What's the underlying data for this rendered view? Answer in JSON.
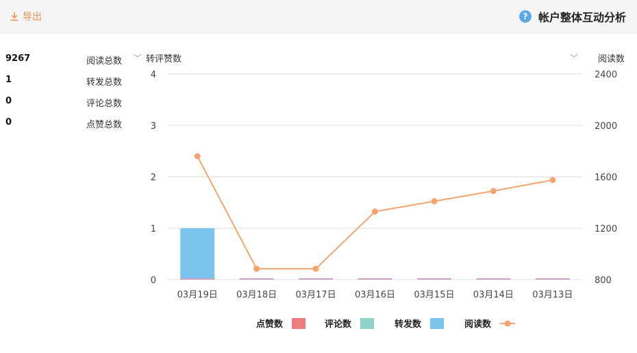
{
  "header": {
    "export_label": "导出",
    "title": "帐户整体互动分析",
    "help_symbol": "?"
  },
  "stats": [
    {
      "label": "阅读总数",
      "value": "9267"
    },
    {
      "label": "转发总数",
      "value": "1"
    },
    {
      "label": "评论总数",
      "value": "0"
    },
    {
      "label": "点赞总数",
      "value": "0"
    }
  ],
  "selectors": {
    "left": "转评赞数",
    "right": "阅读数"
  },
  "colors": {
    "read": "#f5a46f",
    "forward": "#7cc6ee",
    "comment": "#8fd3c9",
    "like": "#ee7d80",
    "grid": "#dddddd",
    "accent": "#f0914e"
  },
  "chart_data": {
    "type": "bar",
    "categories": [
      "03月13日",
      "03月14日",
      "03月15日",
      "03月16日",
      "03月17日",
      "03月18日",
      "03月19日"
    ],
    "series": [
      {
        "name": "阅读数",
        "kind": "line",
        "axis": "right",
        "values": [
          1575,
          1490,
          1410,
          1330,
          885,
          885,
          1760
        ]
      },
      {
        "name": "转发数",
        "kind": "bar",
        "axis": "left",
        "values": [
          0,
          0,
          0,
          0,
          0,
          0,
          1
        ]
      },
      {
        "name": "评论数",
        "kind": "bar",
        "axis": "left",
        "values": [
          0,
          0,
          0,
          0,
          0,
          0,
          0
        ]
      },
      {
        "name": "点赞数",
        "kind": "bar",
        "axis": "left",
        "values": [
          0,
          0,
          0,
          0,
          0,
          0,
          0
        ]
      }
    ],
    "left_axis": {
      "min": 0,
      "max": 4,
      "ticks": [
        "0",
        "1",
        "2",
        "3",
        "4"
      ]
    },
    "right_axis": {
      "min": 800,
      "max": 2400,
      "ticks": [
        "800",
        "1200",
        "1600",
        "2000",
        "2400"
      ]
    },
    "x_reversed": true,
    "grid": true,
    "legend": "bottom"
  }
}
